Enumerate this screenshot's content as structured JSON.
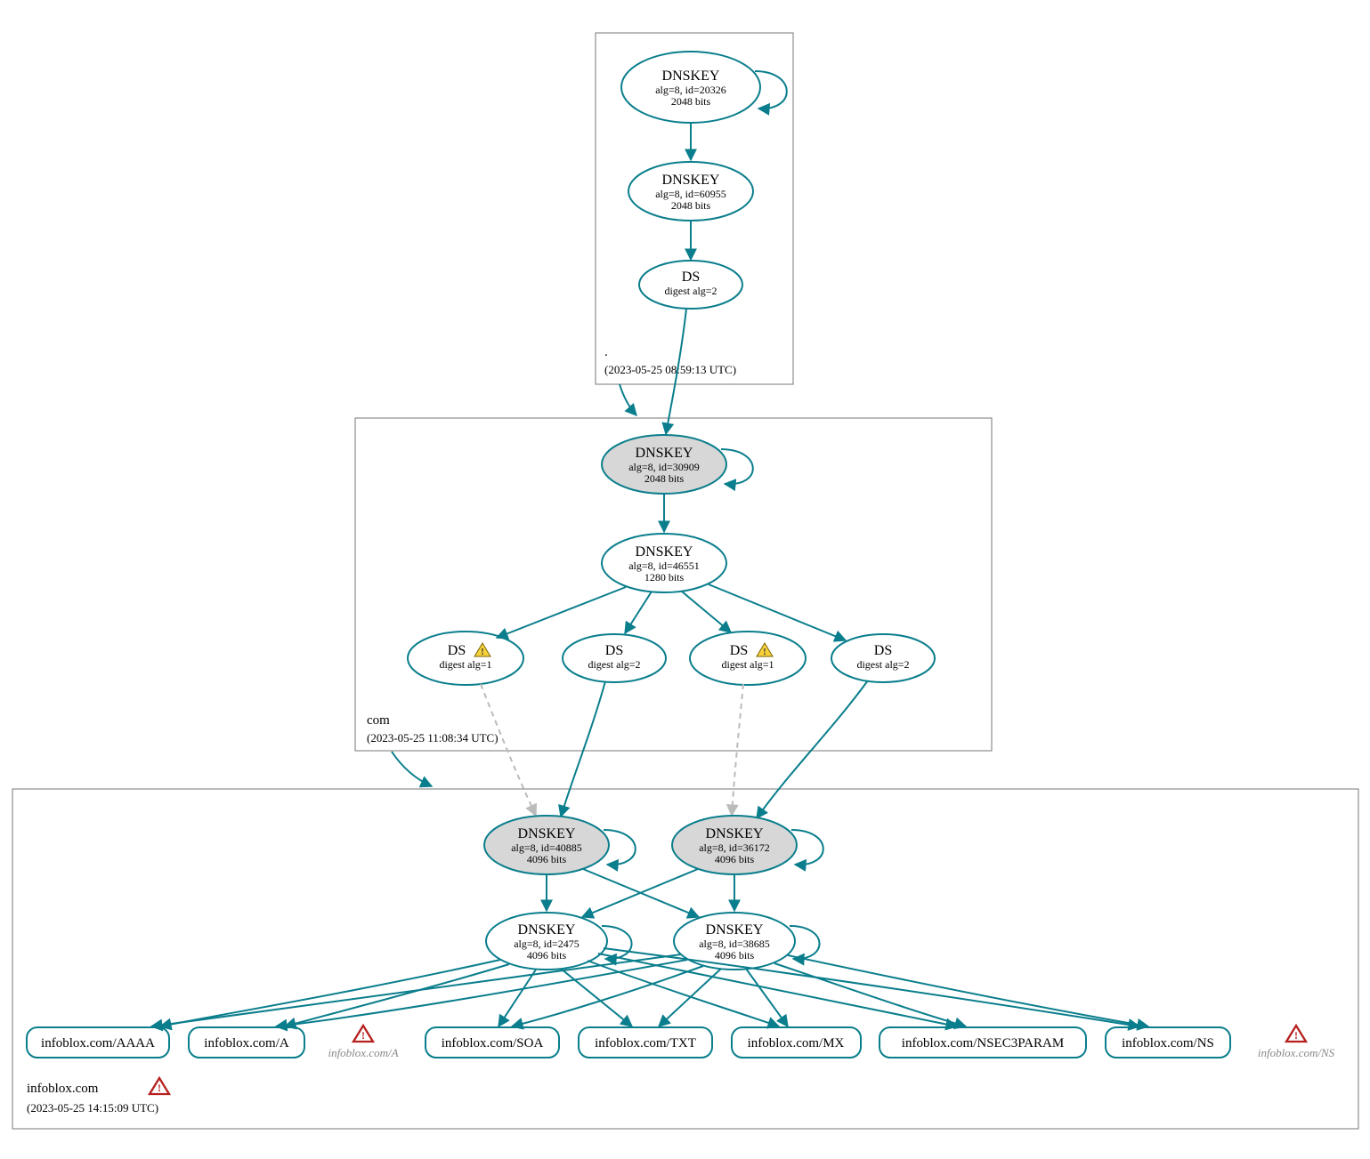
{
  "colors": {
    "stroke": "#0a7e8c",
    "ksk_fill": "#d7d7d7",
    "warn_fill": "#f7d13b",
    "err_stroke": "#b5201f"
  },
  "zones": {
    "root": {
      "label": ".",
      "ts": "(2023-05-25 08:59:13 UTC)"
    },
    "com": {
      "label": "com",
      "ts": "(2023-05-25 11:08:34 UTC)"
    },
    "infoblox": {
      "label": "infoblox.com",
      "ts": "(2023-05-25 14:15:09 UTC)"
    }
  },
  "nodes": {
    "root_ksk": {
      "t": "DNSKEY",
      "l2": "alg=8, id=20326",
      "l3": "2048 bits",
      "ksk": true,
      "double": true
    },
    "root_zsk": {
      "t": "DNSKEY",
      "l2": "alg=8, id=60955",
      "l3": "2048 bits"
    },
    "root_ds": {
      "t": "DS",
      "l2": "digest alg=2"
    },
    "com_ksk": {
      "t": "DNSKEY",
      "l2": "alg=8, id=30909",
      "l3": "2048 bits",
      "ksk": true
    },
    "com_zsk": {
      "t": "DNSKEY",
      "l2": "alg=8, id=46551",
      "l3": "1280 bits"
    },
    "com_ds1": {
      "t": "DS",
      "l2": "digest alg=1",
      "warn": true
    },
    "com_ds2": {
      "t": "DS",
      "l2": "digest alg=2"
    },
    "com_ds3": {
      "t": "DS",
      "l2": "digest alg=1",
      "warn": true
    },
    "com_ds4": {
      "t": "DS",
      "l2": "digest alg=2"
    },
    "ib_ksk1": {
      "t": "DNSKEY",
      "l2": "alg=8, id=40885",
      "l3": "4096 bits",
      "ksk": true
    },
    "ib_ksk2": {
      "t": "DNSKEY",
      "l2": "alg=8, id=36172",
      "l3": "4096 bits",
      "ksk": true
    },
    "ib_zsk1": {
      "t": "DNSKEY",
      "l2": "alg=8, id=2475",
      "l3": "4096 bits"
    },
    "ib_zsk2": {
      "t": "DNSKEY",
      "l2": "alg=8, id=38685",
      "l3": "4096 bits"
    }
  },
  "rrsets": {
    "aaaa": "infoblox.com/AAAA",
    "a": "infoblox.com/A",
    "soa": "infoblox.com/SOA",
    "txt": "infoblox.com/TXT",
    "mx": "infoblox.com/MX",
    "nsec3": "infoblox.com/NSEC3PARAM",
    "ns": "infoblox.com/NS"
  },
  "unknown": {
    "a": "infoblox.com/A",
    "ns": "infoblox.com/NS"
  }
}
